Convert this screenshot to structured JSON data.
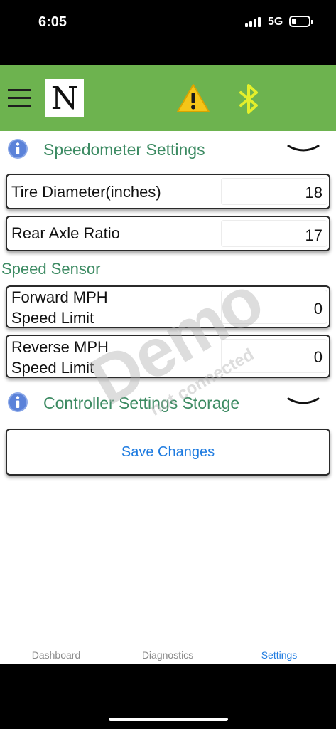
{
  "status_bar": {
    "time": "6:05",
    "network": "5G",
    "icons": [
      "signal-icon",
      "battery-icon"
    ]
  },
  "header": {
    "logo_letter": "N",
    "icons": [
      "menu-icon",
      "warning-icon",
      "bluetooth-icon"
    ],
    "colors": {
      "background": "#6db34f",
      "warning": "#f5c518",
      "bluetooth": "#e4ef2b"
    }
  },
  "speedometer": {
    "title": "Speedometer Settings",
    "fields": [
      {
        "label": "Tire Diameter(inches)",
        "value": "18"
      },
      {
        "label": "Rear Axle Ratio",
        "value": "17"
      }
    ]
  },
  "speed_sensor": {
    "title": "Speed Sensor",
    "fields": [
      {
        "label_line1": "Forward MPH",
        "label_line2": "Speed Limit",
        "value": "0"
      },
      {
        "label_line1": "Reverse MPH",
        "label_line2": "Speed Limit",
        "value": "0"
      }
    ]
  },
  "controller_storage": {
    "title": "Controller Settings Storage",
    "save_label": "Save Changes"
  },
  "watermark": {
    "main": "Demo",
    "sub": "not connected"
  },
  "tabs": [
    {
      "label": "Dashboard",
      "active": false
    },
    {
      "label": "Diagnostics",
      "active": false
    },
    {
      "label": "Settings",
      "active": true
    }
  ],
  "colors": {
    "section_title": "#3d8b63",
    "accent_blue": "#1e7be0"
  }
}
